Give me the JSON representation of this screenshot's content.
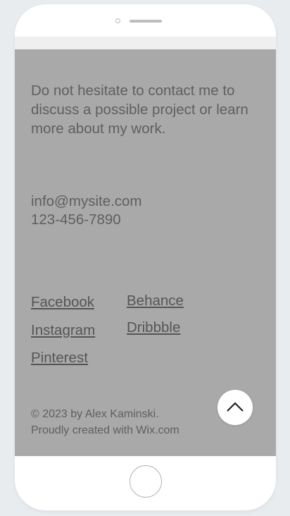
{
  "colors": {
    "screen_background": "#a9a9a9",
    "text": "#5f5f5f",
    "device_frame": "#ffffff",
    "page_background": "#e8ecef"
  },
  "intro": {
    "text": "Do not hesitate to contact me to discuss a possible project or learn more about my work."
  },
  "contact": {
    "email": "info@mysite.com",
    "phone": "123-456-7890"
  },
  "social_links": {
    "facebook": "Facebook",
    "instagram": "Instagram",
    "pinterest": "Pinterest",
    "behance": "Behance",
    "dribbble": "Dribbble"
  },
  "footer": {
    "copyright": "© 2023 by Alex Kaminski.",
    "credit": "Proudly created with Wix.com"
  },
  "icons": {
    "back_to_top": "chevron-up-icon"
  }
}
